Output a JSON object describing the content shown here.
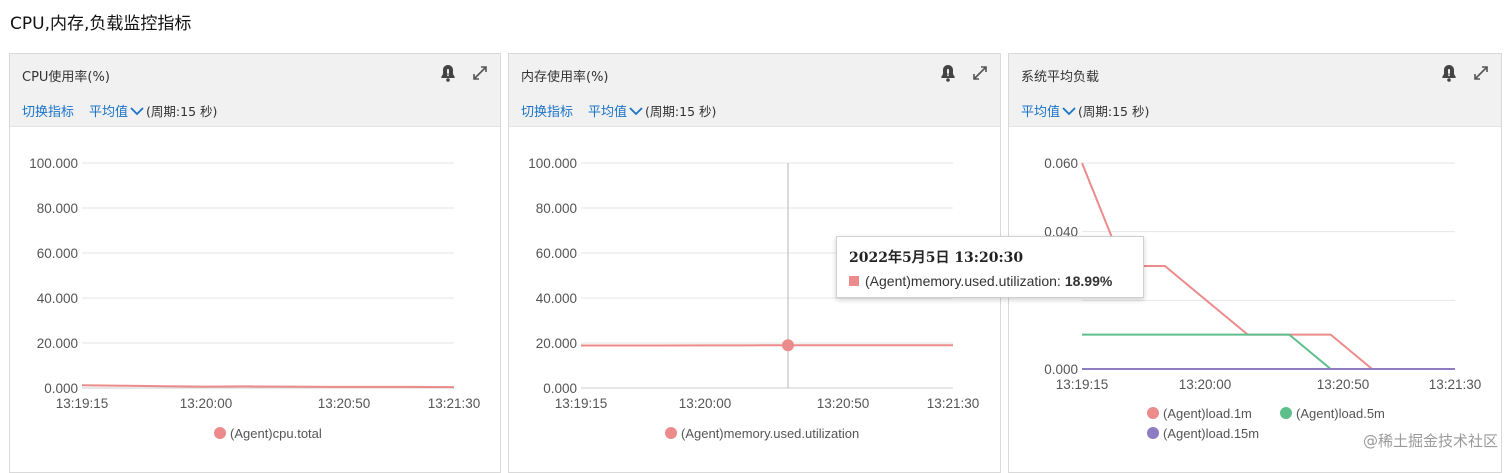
{
  "page": {
    "title": "CPU,内存,负载监控指标"
  },
  "colors": {
    "series1": "#ec8b8b",
    "series2": "#5fbf8c",
    "series3": "#8e7cc3",
    "link": "#1a73c8",
    "grid": "#e6e6e6",
    "header_bg": "#f1f1f1"
  },
  "icons": [
    "bell-icon",
    "expand-icon",
    "chevron-down-icon"
  ],
  "panels": [
    {
      "title": "CPU使用率(%)",
      "switch_label": "切换指标",
      "aggregation": "平均值",
      "period": "(周期:15 秒)"
    },
    {
      "title": "内存使用率(%)",
      "switch_label": "切换指标",
      "aggregation": "平均值",
      "period": "(周期:15 秒)"
    },
    {
      "title": "系统平均负载",
      "aggregation": "平均值",
      "period": "(周期:15 秒)"
    }
  ],
  "tooltip": {
    "time": "2022年5月5日 13:20:30",
    "series": "(Agent)memory.used.utilization:",
    "value": "18.99%"
  },
  "watermark": "@稀土掘金技术社区",
  "chart_data": [
    {
      "type": "line",
      "x": [
        "13:19:15",
        "13:19:30",
        "13:19:45",
        "13:20:00",
        "13:20:15",
        "13:20:30",
        "13:20:45",
        "13:21:00",
        "13:21:15",
        "13:21:30"
      ],
      "x_ticks": [
        "13:19:15",
        "13:20:00",
        "13:20:50",
        "13:21:30"
      ],
      "y_ticks": [
        "0.000",
        "20.000",
        "40.000",
        "60.000",
        "80.000",
        "100.000"
      ],
      "ylim": [
        0,
        100
      ],
      "grid": true,
      "legend_position": "bottom",
      "series": [
        {
          "name": "(Agent)cpu.total",
          "values": [
            1.2,
            1.0,
            0.8,
            0.6,
            0.7,
            0.6,
            0.5,
            0.5,
            0.5,
            0.4
          ]
        }
      ]
    },
    {
      "type": "line",
      "x": [
        "13:19:15",
        "13:19:30",
        "13:19:45",
        "13:20:00",
        "13:20:15",
        "13:20:30",
        "13:20:45",
        "13:21:00",
        "13:21:15",
        "13:21:30"
      ],
      "x_ticks": [
        "13:19:15",
        "13:20:00",
        "13:20:50",
        "13:21:30"
      ],
      "y_ticks": [
        "0.000",
        "20.000",
        "40.000",
        "60.000",
        "80.000",
        "100.000"
      ],
      "ylim": [
        0,
        100
      ],
      "grid": true,
      "legend_position": "bottom",
      "series": [
        {
          "name": "(Agent)memory.used.utilization",
          "values": [
            18.9,
            18.9,
            18.9,
            18.95,
            18.97,
            18.99,
            18.99,
            18.99,
            18.99,
            18.99
          ]
        }
      ]
    },
    {
      "type": "line",
      "x": [
        "13:19:15",
        "13:19:30",
        "13:19:45",
        "13:20:00",
        "13:20:15",
        "13:20:30",
        "13:20:45",
        "13:21:00",
        "13:21:15",
        "13:21:30"
      ],
      "x_ticks": [
        "13:19:15",
        "13:20:00",
        "13:20:50",
        "13:21:30"
      ],
      "y_ticks": [
        "0.000",
        "",
        "0.040",
        "0.060"
      ],
      "ylim": [
        0,
        0.06
      ],
      "grid": true,
      "legend_position": "bottom",
      "series": [
        {
          "name": "(Agent)load.1m",
          "values": [
            0.06,
            0.03,
            0.03,
            0.02,
            0.01,
            0.01,
            0.01,
            0.0,
            0.0,
            0.0
          ]
        },
        {
          "name": "(Agent)load.5m",
          "values": [
            0.01,
            0.01,
            0.01,
            0.01,
            0.01,
            0.01,
            0.0,
            0.0,
            0.0,
            0.0
          ]
        },
        {
          "name": "(Agent)load.15m",
          "values": [
            0.0,
            0.0,
            0.0,
            0.0,
            0.0,
            0.0,
            0.0,
            0.0,
            0.0,
            0.0
          ]
        }
      ]
    }
  ]
}
